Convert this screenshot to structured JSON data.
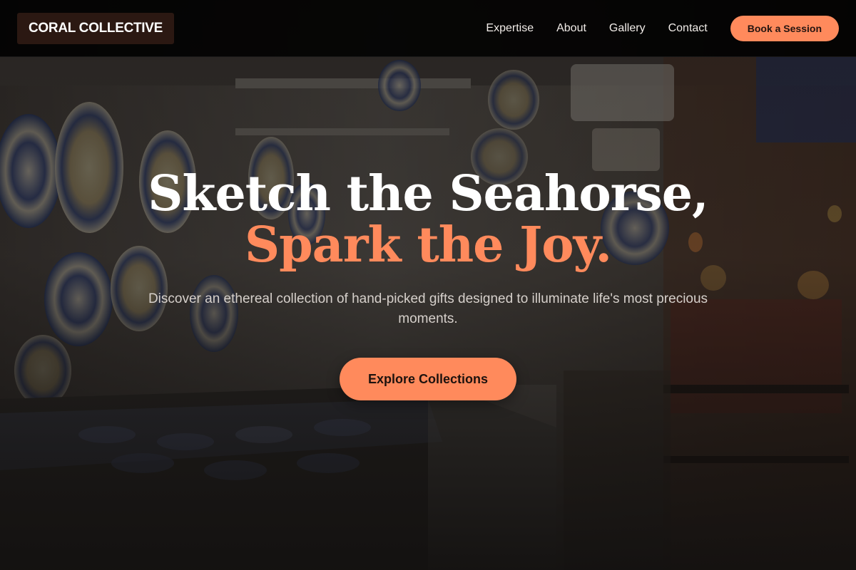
{
  "brand": {
    "name": "CORAL COLLECTIVE"
  },
  "nav": {
    "links": [
      "Expertise",
      "About",
      "Gallery",
      "Contact"
    ],
    "cta_label": "Book a Session"
  },
  "hero": {
    "headline_line1": "Sketch the Seahorse,",
    "headline_line2": "Spark the Joy.",
    "subtitle": "Discover an ethereal collection of hand-picked gifts designed to illuminate life's most precious moments.",
    "cta_label": "Explore Collections",
    "background_image": "ceramics-shop-photo"
  },
  "colors": {
    "accent": "#ff8a5c",
    "nav_background": "#000000",
    "logo_background": "#2b1812",
    "headline": "#ffffff",
    "subtitle": "#d6d0cb"
  }
}
